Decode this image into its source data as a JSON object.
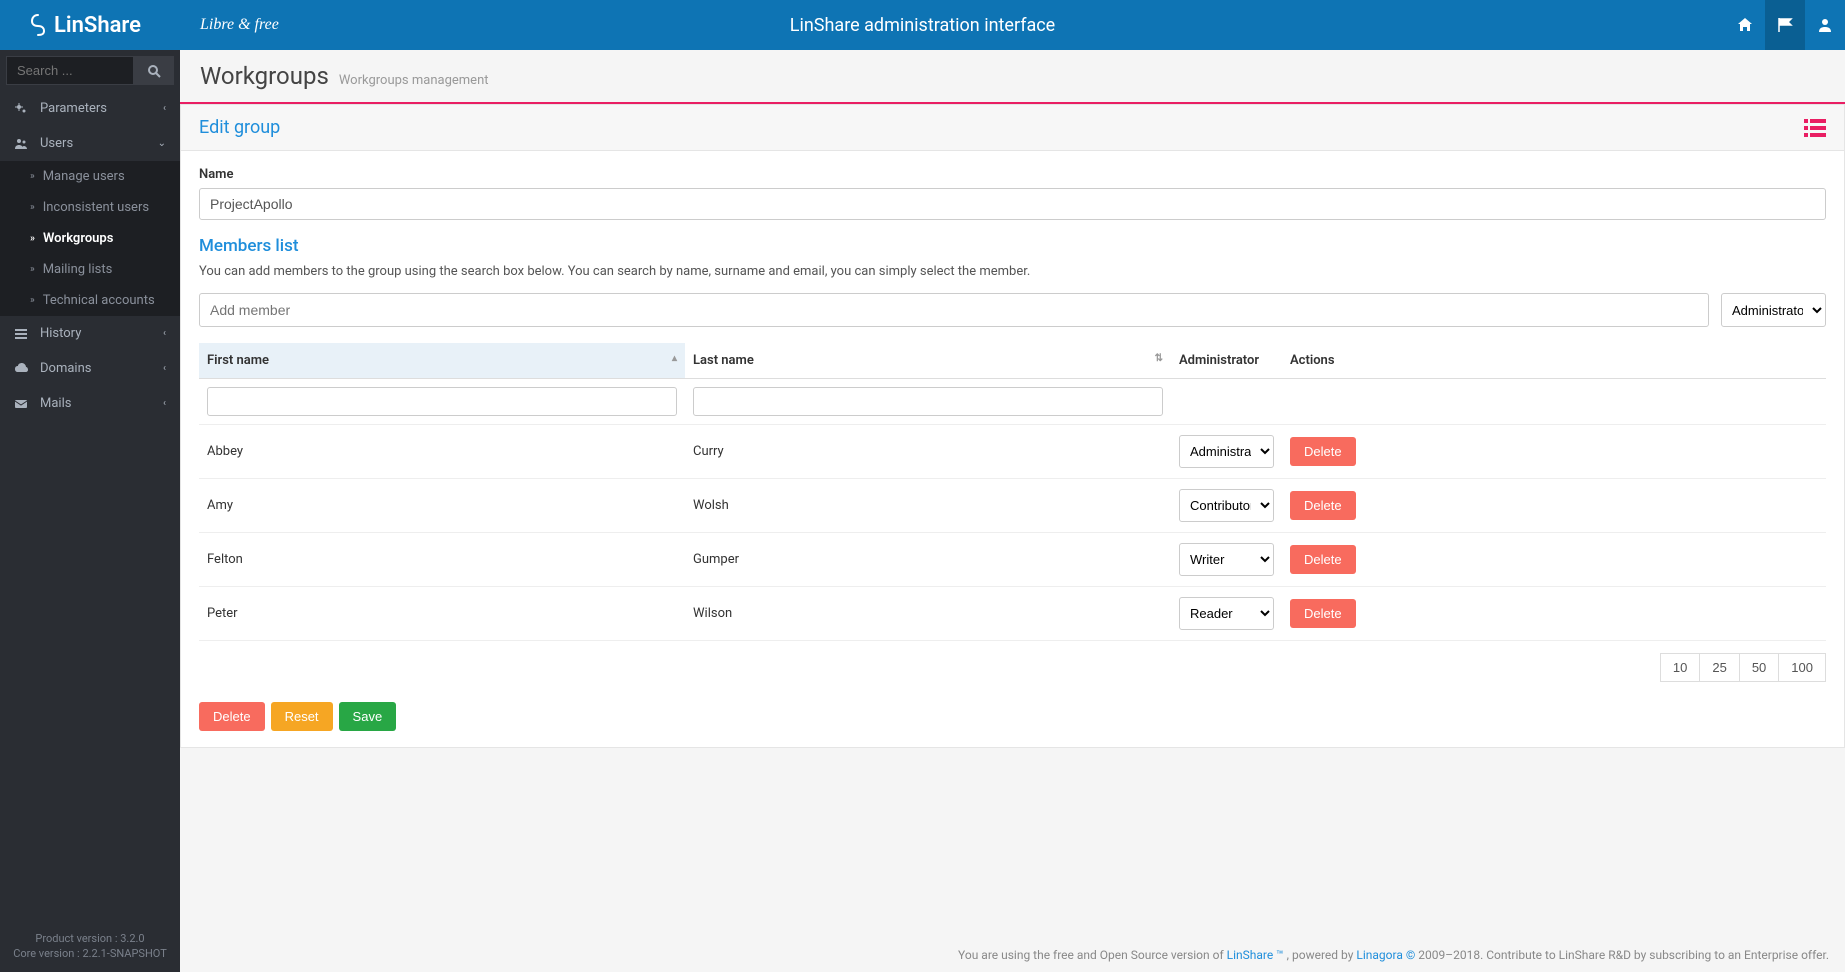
{
  "brand": {
    "name": "LinShare",
    "tagline": "Libre & free"
  },
  "header": {
    "title": "LinShare administration interface"
  },
  "search": {
    "placeholder": "Search ..."
  },
  "nav": {
    "parameters": "Parameters",
    "users": "Users",
    "users_sub": {
      "manage": "Manage users",
      "inconsistent": "Inconsistent users",
      "workgroups": "Workgroups",
      "mailing": "Mailing lists",
      "technical": "Technical accounts"
    },
    "history": "History",
    "domains": "Domains",
    "mails": "Mails"
  },
  "version": {
    "product": "Product version : 3.2.0",
    "core": "Core version : 2.2.1-SNAPSHOT"
  },
  "page": {
    "title": "Workgroups",
    "subtitle": "Workgroups management"
  },
  "panel": {
    "title": "Edit group"
  },
  "form": {
    "name_label": "Name",
    "name_value": "ProjectApollo",
    "members_title": "Members list",
    "members_desc": "You can add members to the group using the search box below. You can search by name, surname and email, you can simply select the member.",
    "add_member_placeholder": "Add member",
    "default_role": "Administrator"
  },
  "table": {
    "headers": {
      "first": "First name",
      "last": "Last name",
      "admin": "Administrator",
      "actions": "Actions"
    },
    "rows": [
      {
        "first": "Abbey",
        "last": "Curry",
        "role": "Administrator"
      },
      {
        "first": "Amy",
        "last": "Wolsh",
        "role": "Contributor"
      },
      {
        "first": "Felton",
        "last": "Gumper",
        "role": "Writer"
      },
      {
        "first": "Peter",
        "last": "Wilson",
        "role": "Reader"
      }
    ],
    "delete_label": "Delete"
  },
  "pagination": [
    "10",
    "25",
    "50",
    "100"
  ],
  "buttons": {
    "delete": "Delete",
    "reset": "Reset",
    "save": "Save"
  },
  "footer": {
    "pre": "You are using the free and Open Source version of ",
    "linshare": "LinShare ™",
    "mid1": " , powered by ",
    "linagora": "Linagora ©",
    "mid2": " 2009–2018. Contribute to LinShare R&D by subscribing to an Enterprise offer."
  }
}
